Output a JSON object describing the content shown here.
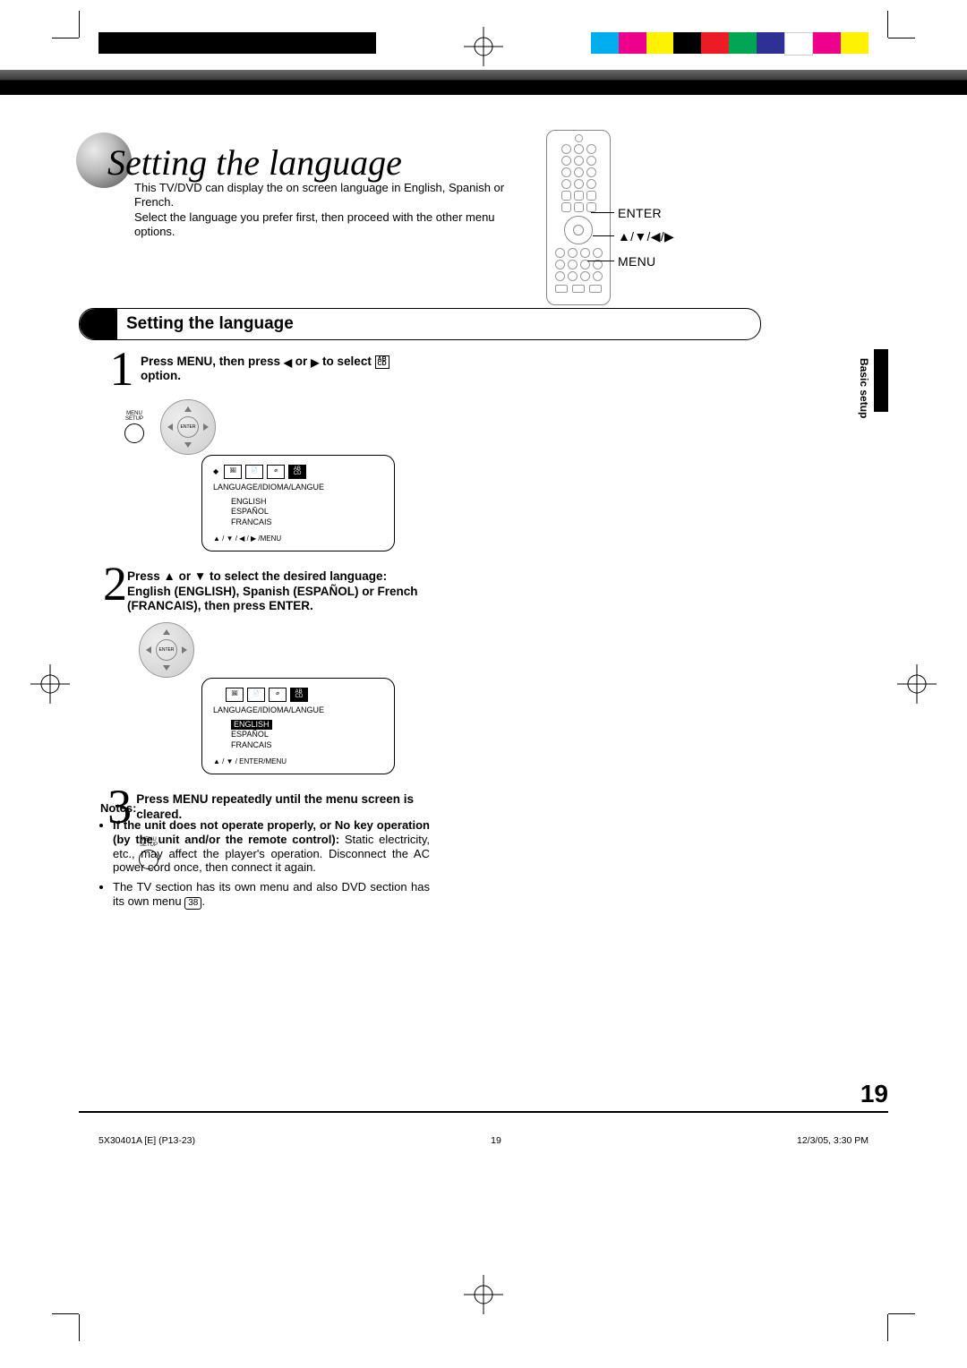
{
  "page": {
    "italic_title": "Setting the language",
    "intro": "This TV/DVD can display the on screen language in English, Spanish or French.\nSelect the language you prefer first, then proceed with the other menu options.",
    "section_heading": "Setting the language",
    "side_tab": "Basic setup",
    "page_number": "19"
  },
  "remote_callouts": {
    "enter": "ENTER",
    "arrows": "▲/▼/◀/▶",
    "menu": "MENU"
  },
  "steps": [
    {
      "num": "1",
      "text_parts": [
        "Press MENU, then press ",
        "◀",
        " or ",
        "▶",
        " to select "
      ],
      "icon_label": "AB\nCD",
      "text_tail": " option.",
      "menu_label": "MENU\nSETUP"
    },
    {
      "num": "2",
      "text": "Press ▲ or ▼ to select the desired language: English (ENGLISH), Spanish (ESPAÑOL) or French (FRANCAIS), then press ENTER."
    },
    {
      "num": "3",
      "text": "Press MENU repeatedly until the menu screen is cleared.",
      "menu_label": "MENU\nSETUP"
    }
  ],
  "osd1": {
    "tabs": [
      "🖼",
      "📄",
      "⌀",
      "AB\nCD"
    ],
    "title": "LANGUAGE/IDIOMA/LANGUE",
    "items": [
      "ENGLISH",
      "ESPAÑOL",
      "FRANCAIS"
    ],
    "footer": "▲ / ▼ / ◀ / ▶ /MENU"
  },
  "osd2": {
    "tabs": [
      "🖼",
      "📄",
      "⌀",
      "AB\nCD"
    ],
    "title": "LANGUAGE/IDIOMA/LANGUE",
    "items": [
      "ENGLISH",
      "ESPAÑOL",
      "FRANCAIS"
    ],
    "highlighted_index": 0,
    "footer": "▲ / ▼ / ENTER/MENU"
  },
  "dpad_center": "ENTER",
  "notes": {
    "heading": "Notes:",
    "items": [
      {
        "bold": "If the unit does not operate properly, or No key operation (by the unit and/or the remote control):",
        "rest": " Static electricity, etc., may affect the player's operation. Disconnect the AC power cord once, then connect it again."
      },
      {
        "bold": "",
        "rest": "The TV section has its own menu and also DVD section has its own menu ",
        "pageref": "38",
        "tail": "."
      }
    ]
  },
  "imprint": {
    "left": "5X30401A [E] (P13-23)",
    "center": "19",
    "right": "12/3/05, 3:30 PM"
  },
  "colorbars": {
    "left": [
      "#000",
      "#000",
      "#000",
      "#000",
      "#000",
      "#000",
      "#000",
      "#000",
      "#000",
      "#000"
    ],
    "right": [
      "#00aeef",
      "#ec008c",
      "#fff200",
      "#000",
      "#ed1c24",
      "#00a651",
      "#2e3192",
      "#fff",
      "#ec008c",
      "#fff200"
    ]
  }
}
